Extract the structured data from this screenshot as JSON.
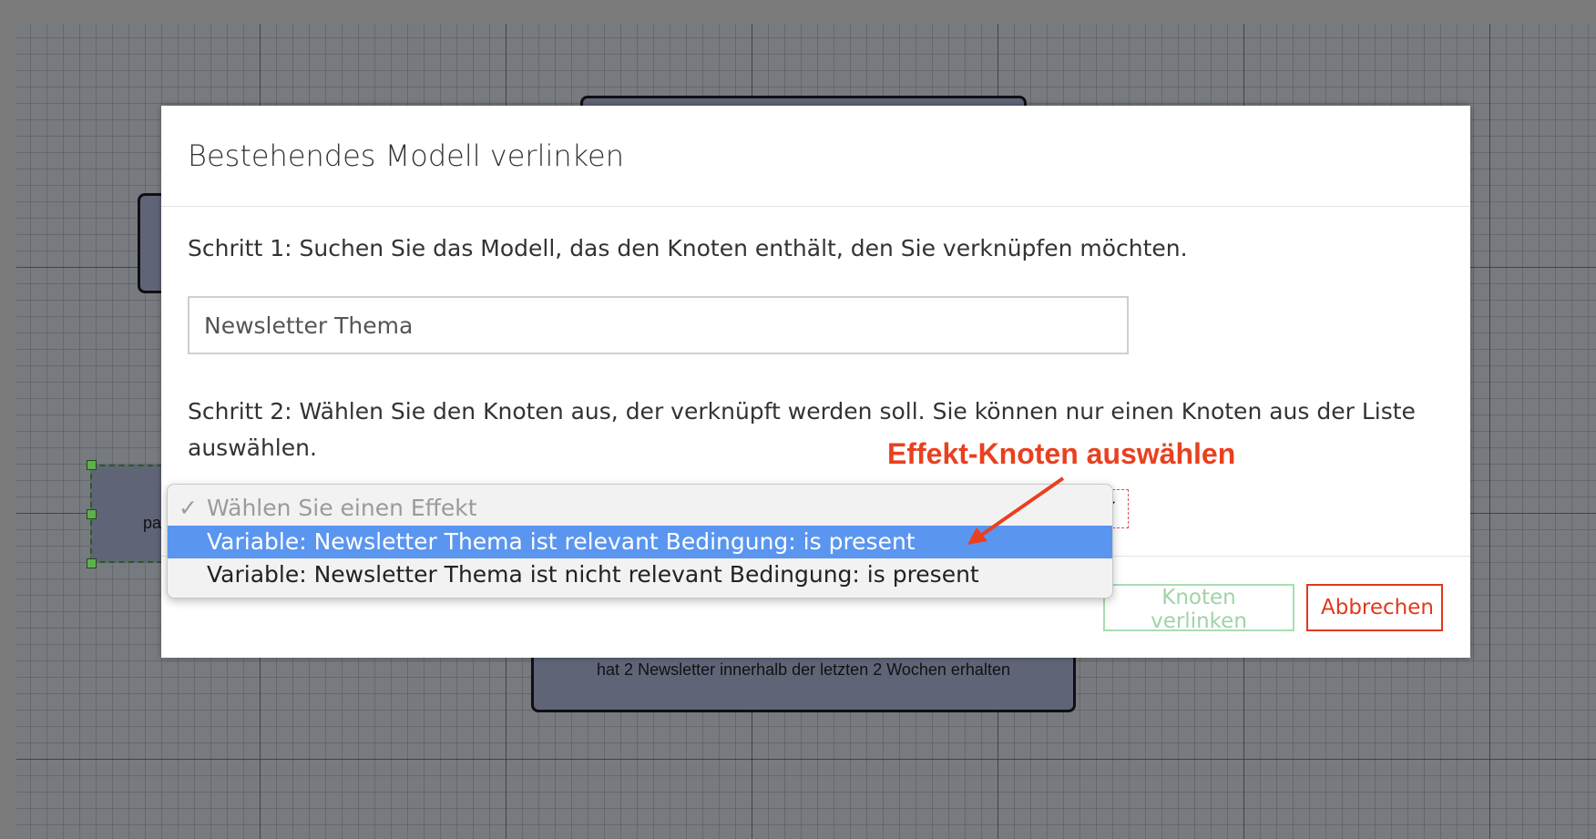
{
  "modal": {
    "title": "Bestehendes Modell verlinken",
    "step1_text": "Schritt 1: Suchen Sie das Modell, das den Knoten enthält, den Sie verknüpfen möchten.",
    "search_value": "Newsletter Thema",
    "step2_text": "Schritt 2: Wählen Sie den Knoten aus, der verknüpft werden soll. Sie können nur einen Knoten aus der Liste auswählen.",
    "select_caret": "✔",
    "buttons": {
      "link_label": "Knoten verlinken",
      "cancel_label": "Abbrechen"
    }
  },
  "dropdown": {
    "checkmark": "✓",
    "placeholder": "Wählen Sie einen Effekt",
    "options": [
      "Variable: Newsletter Thema ist relevant Bedingung: is present",
      "Variable: Newsletter Thema ist nicht relevant Bedingung: is present"
    ],
    "selected_index": 0
  },
  "canvas": {
    "node_bottom_text": "hat 2 Newsletter innerhalb der letzten 2 Wochen erhalten",
    "node_selected_text": "pa"
  },
  "annotation": {
    "text": "Effekt-Knoten auswählen",
    "color": "#e9401f"
  },
  "colors": {
    "selected_option": "#5a96f0",
    "cancel": "#e0391c",
    "link_button": "#9fd4a8",
    "node_fill": "#5f6577"
  }
}
